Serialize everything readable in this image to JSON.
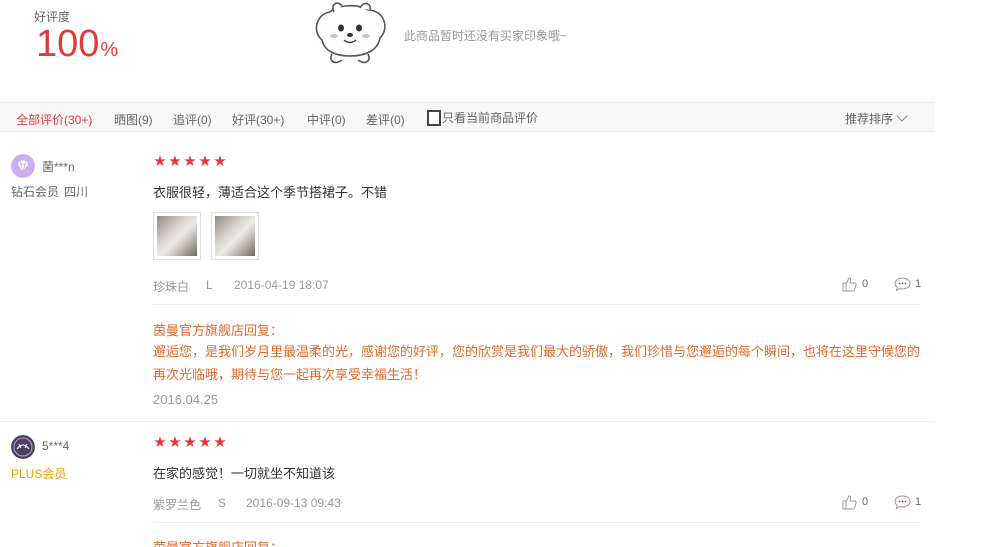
{
  "summary": {
    "rate_label": "好评度",
    "rate_value": "100",
    "rate_unit": "%",
    "no_impression": "此商品暂时还没有买家印象哦~"
  },
  "filters": {
    "tabs": [
      "全部评价(30+)",
      "晒图(9)",
      "追评(0)",
      "好评(30+)",
      "中评(0)",
      "差评(0)"
    ],
    "active_tab": 0,
    "only_current_label": "只看当前商品评价",
    "sort_label": "推荐排序"
  },
  "colors": {
    "accent": "#e4393c",
    "reply": "#e4682a",
    "plus": "#e4a300"
  },
  "reviews": [
    {
      "user": "菌***n",
      "level": "钻石会员",
      "location": "四川",
      "avatar_icon": "diamond-icon",
      "stars": 5,
      "content": "衣服很轻，薄适合这个季节搭裙子。不错",
      "images": 2,
      "color": "珍珠白",
      "size": "L",
      "date": "2016-04-19 18:07",
      "likes": "0",
      "replies": "1",
      "reply": {
        "header": "茵曼官方旗舰店回复：",
        "text": "邂逅您，是我们岁月里最温柔的光，感谢您的好评，您的欣赏是我们最大的骄傲，我们珍惜与您邂逅的每个瞬间，也将在这里守候您的再次光临哦，期待与您一起再次享受幸福生活！",
        "date": "2016.04.25"
      }
    },
    {
      "user": "5***4",
      "level": "PLUS会员",
      "avatar_icon": "user-avatar",
      "stars": 5,
      "content": "在家的感觉！一切就坐不知道该",
      "color": "紫罗兰色",
      "size": "S",
      "date": "2016-09-13 09:43",
      "likes": "0",
      "replies": "1",
      "reply": {
        "header": "茵曼官方旗舰店回复："
      }
    }
  ]
}
